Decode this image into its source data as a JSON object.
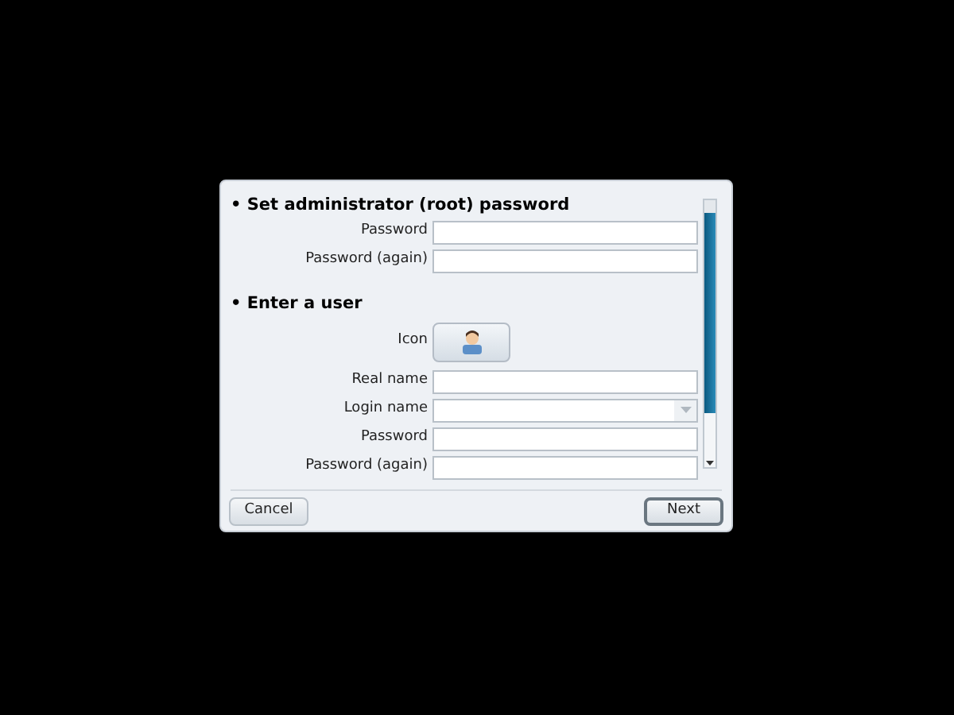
{
  "sections": [
    {
      "heading": "Set administrator (root) password",
      "bullet": "•",
      "rows": [
        {
          "kind": "text",
          "label": "Password"
        },
        {
          "kind": "text",
          "label": "Password (again)"
        }
      ]
    },
    {
      "heading": "Enter a user",
      "bullet": "•",
      "rows": [
        {
          "kind": "icon",
          "label": "Icon"
        },
        {
          "kind": "text",
          "label": "Real name"
        },
        {
          "kind": "combo",
          "label": "Login name"
        },
        {
          "kind": "text",
          "label": "Password"
        },
        {
          "kind": "text",
          "label": "Password (again)"
        }
      ]
    }
  ],
  "buttons": [
    {
      "label": "Cancel",
      "default": false
    },
    {
      "label": "Next",
      "default": true
    }
  ]
}
